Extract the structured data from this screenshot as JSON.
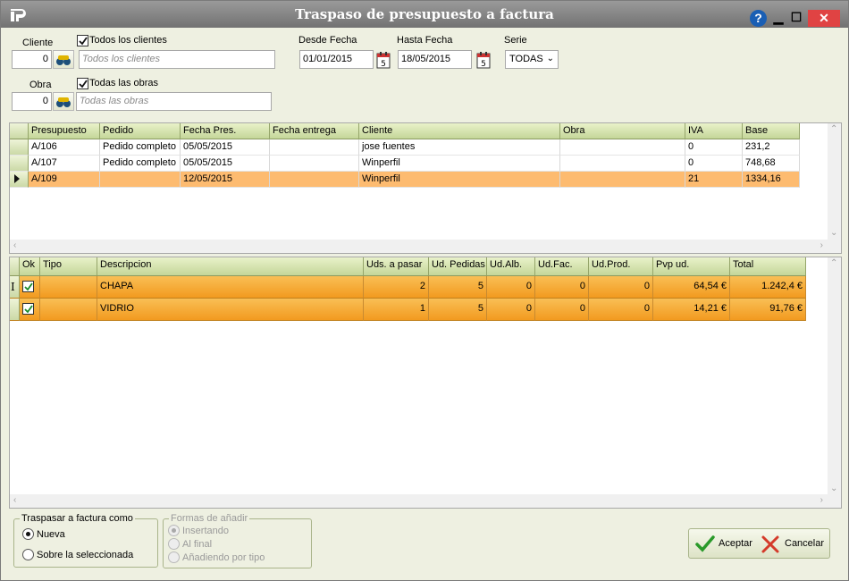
{
  "window": {
    "title": "Traspaso de presupuesto a factura"
  },
  "colors": {
    "accent_orange": "#f29a1f",
    "selected_row": "#fdbb70",
    "header_green": "#c4d699"
  },
  "filters": {
    "cliente_label": "Cliente",
    "cliente_value": "0",
    "todos_clientes_label": "Todos los clientes",
    "todos_clientes_checked": true,
    "cliente_name_placeholder": "Todos los clientes",
    "obra_label": "Obra",
    "obra_value": "0",
    "todas_obras_label": "Todas las obras",
    "todas_obras_checked": true,
    "obra_name_placeholder": "Todas las obras",
    "desde_label": "Desde Fecha",
    "desde_value": "01/01/2015",
    "hasta_label": "Hasta Fecha",
    "hasta_value": "18/05/2015",
    "serie_label": "Serie",
    "serie_value": "TODAS"
  },
  "budgets": {
    "headers": [
      "Presupuesto",
      "Pedido",
      "Fecha Pres.",
      "Fecha entrega",
      "Cliente",
      "Obra",
      "IVA",
      "Base"
    ],
    "rows": [
      [
        "A/106",
        "Pedido completo",
        "05/05/2015",
        "",
        "jose fuentes",
        "",
        "0",
        "231,2"
      ],
      [
        "A/107",
        "Pedido completo",
        "05/05/2015",
        "",
        "Winperfil",
        "",
        "0",
        "748,68"
      ],
      [
        "A/109",
        "",
        "12/05/2015",
        "",
        "Winperfil",
        "",
        "21",
        "1334,16"
      ]
    ],
    "selected_row": 2
  },
  "lines": {
    "headers": [
      "Ok",
      "Tipo",
      "Descripcion",
      "Uds. a pasar",
      "Ud. Pedidas",
      "Ud.Alb.",
      "Ud.Fac.",
      "Ud.Prod.",
      "Pvp ud.",
      "Total"
    ],
    "rows": [
      {
        "ok": true,
        "tipo": "",
        "descripcion": "CHAPA",
        "uds_pasar": "2",
        "ud_pedidas": "5",
        "ud_alb": "0",
        "ud_fac": "0",
        "ud_prod": "0",
        "pvp": "64,54 €",
        "total": "1.242,4 €"
      },
      {
        "ok": true,
        "tipo": "",
        "descripcion": "VIDRIO",
        "uds_pasar": "1",
        "ud_pedidas": "5",
        "ud_alb": "0",
        "ud_fac": "0",
        "ud_prod": "0",
        "pvp": "14,21 €",
        "total": "91,76 €"
      }
    ]
  },
  "options": {
    "traspasar_legend": "Traspasar a factura como",
    "nueva_label": "Nueva",
    "nueva_selected": true,
    "sobre_label": "Sobre la seleccionada",
    "formas_legend": "Formas de añadir",
    "insertando_label": "Insertando",
    "al_final_label": "Al final",
    "por_tipo_label": "Añadiendo por tipo"
  },
  "actions": {
    "aceptar_label": "Aceptar",
    "cancelar_label": "Cancelar"
  },
  "icons": [
    "app-logo-icon",
    "help-icon",
    "minimize-icon",
    "maximize-icon",
    "close-icon",
    "binoculars-icon",
    "calendar-icon",
    "checkmark-icon",
    "cross-icon",
    "row-pointer-icon",
    "text-cursor-icon"
  ]
}
